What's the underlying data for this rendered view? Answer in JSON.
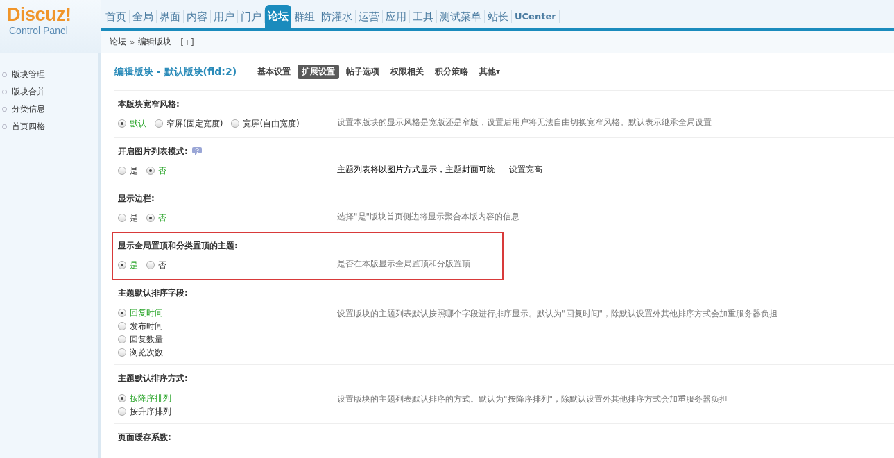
{
  "logo": {
    "name": "Discuz!",
    "subtitle": "Control Panel"
  },
  "nav": [
    {
      "label": "首页",
      "selected": false
    },
    {
      "label": "全局",
      "selected": false
    },
    {
      "label": "界面",
      "selected": false
    },
    {
      "label": "内容",
      "selected": false
    },
    {
      "label": "用户",
      "selected": false
    },
    {
      "label": "门户",
      "selected": false
    },
    {
      "label": "论坛",
      "selected": true
    },
    {
      "label": "群组",
      "selected": false
    },
    {
      "label": "防灌水",
      "selected": false
    },
    {
      "label": "运营",
      "selected": false
    },
    {
      "label": "应用",
      "selected": false
    },
    {
      "label": "工具",
      "selected": false
    },
    {
      "label": "测试菜单",
      "selected": false
    },
    {
      "label": "站长",
      "selected": false
    },
    {
      "label": "UCenter",
      "selected": false
    }
  ],
  "breadcrumb": {
    "items": [
      "论坛",
      "编辑版块"
    ],
    "separator": "»",
    "add": "[+]"
  },
  "sidebar": {
    "items": [
      "版块管理",
      "版块合并",
      "分类信息",
      "首页四格"
    ]
  },
  "page": {
    "title": "编辑版块 - 默认版块(fid:2)",
    "tabs": [
      {
        "label": "基本设置",
        "selected": false
      },
      {
        "label": "扩展设置",
        "selected": true
      },
      {
        "label": "帖子选项",
        "selected": false
      },
      {
        "label": "权限相关",
        "selected": false
      },
      {
        "label": "积分策略",
        "selected": false
      },
      {
        "label": "其他▾",
        "selected": false
      }
    ]
  },
  "settings": [
    {
      "label": "本版块宽窄风格:",
      "kind": "inline",
      "options": [
        {
          "label": "默认",
          "selected": true
        },
        {
          "label": "窄屏(固定宽度)",
          "selected": false
        },
        {
          "label": "宽屏(自由宽度)",
          "selected": false
        }
      ],
      "description": "设置本版块的显示风格是宽版还是窄版，设置后用户将无法自由切换宽窄风格。默认表示继承全局设置"
    },
    {
      "label": "开启图片列表模式:",
      "kind": "inline",
      "help": true,
      "options": [
        {
          "label": "是",
          "selected": false
        },
        {
          "label": "否",
          "selected": true
        }
      ],
      "description": "主题列表将以图片方式显示，主题封面可统一",
      "link": "设置宽高",
      "description_dark": true
    },
    {
      "label": "显示边栏:",
      "kind": "inline",
      "options": [
        {
          "label": "是",
          "selected": false
        },
        {
          "label": "否",
          "selected": true
        }
      ],
      "description": "选择\"是\"版块首页侧边将显示聚合本版内容的信息"
    },
    {
      "label": "显示全局置顶和分类置顶的主题:",
      "kind": "inline",
      "highlighted": true,
      "options": [
        {
          "label": "是",
          "selected": true
        },
        {
          "label": "否",
          "selected": false
        }
      ],
      "description": "是否在本版显示全局置顶和分版置顶"
    },
    {
      "label": "主题默认排序字段:",
      "kind": "list",
      "options": [
        {
          "label": "回复时间",
          "selected": true
        },
        {
          "label": "发布时间",
          "selected": false
        },
        {
          "label": "回复数量",
          "selected": false
        },
        {
          "label": "浏览次数",
          "selected": false
        }
      ],
      "description": "设置版块的主题列表默认按照哪个字段进行排序显示。默认为\"回复时间\"，除默认设置外其他排序方式会加重服务器负担"
    },
    {
      "label": "主题默认排序方式:",
      "kind": "list",
      "options": [
        {
          "label": "按降序排列",
          "selected": true
        },
        {
          "label": "按升序排列",
          "selected": false
        }
      ],
      "description": "设置版块的主题列表默认排序的方式。默认为\"按降序排列\"，除默认设置外其他排序方式会加重服务器负担"
    },
    {
      "label": "页面缓存系数:",
      "kind": "cut"
    }
  ]
}
